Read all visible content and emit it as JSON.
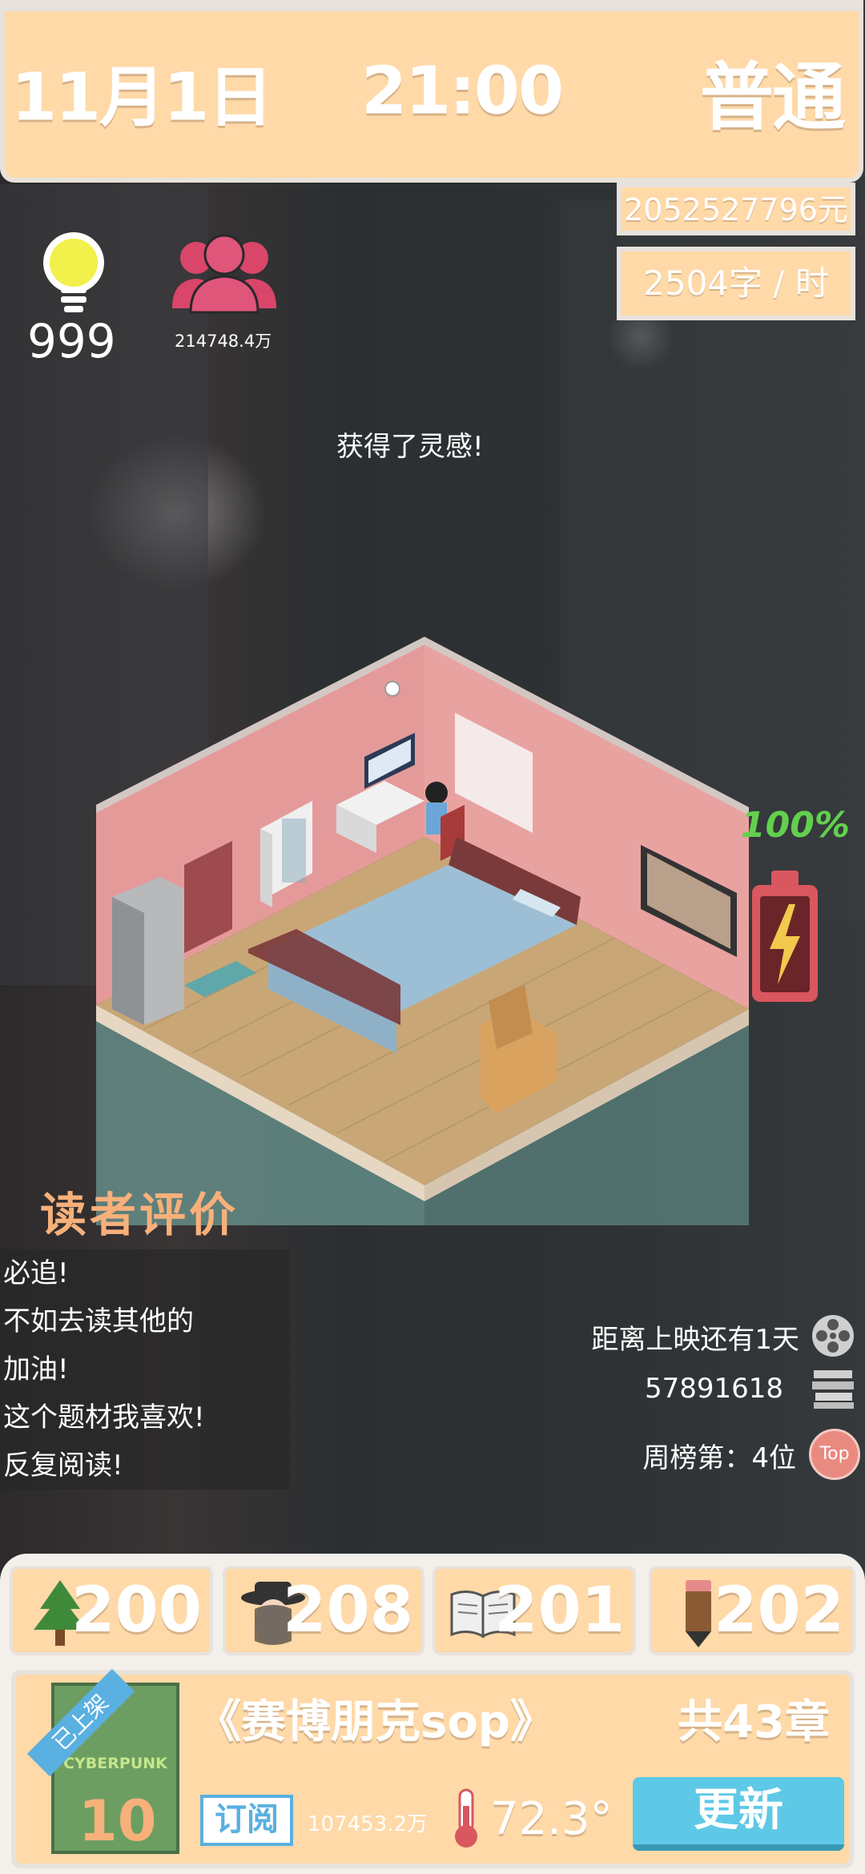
{
  "header": {
    "date": "11月1日",
    "time": "21:00",
    "difficulty": "普通",
    "money": "2052527796元",
    "speed": "2504字 / 时"
  },
  "stats": {
    "inspiration": "999",
    "fans": "214748.4万"
  },
  "notice": "获得了灵感!",
  "battery": {
    "label": "100%",
    "level": 1.0
  },
  "reviews": {
    "title": "读者评价",
    "items": [
      "必追!",
      "不如去读其他的",
      "加油!",
      "这个题材我喜欢!",
      "反复阅读!"
    ]
  },
  "info": {
    "release": "距离上映还有1天",
    "count": "57891618",
    "rank": "周榜第：4位",
    "rank_badge": "Top"
  },
  "resources": [
    {
      "icon": "tree-icon",
      "value": "200"
    },
    {
      "icon": "detective-icon",
      "value": "208"
    },
    {
      "icon": "open-book-icon",
      "value": "201"
    },
    {
      "icon": "pencil-icon",
      "value": "202"
    }
  ],
  "book": {
    "ribbon": "已上架",
    "cover_text": "CYBERPUNK",
    "cover_number": "10",
    "title": "《赛博朋克sop》",
    "chapters": "共43章",
    "subscribe_label": "订阅",
    "subscribers": "107453.2万",
    "heat": "72.3°",
    "update_label": "更新"
  },
  "colors": {
    "panel": "#ffd9a8",
    "accent_pink": "#d9466a",
    "update_button": "#5ec9e6",
    "battery": "#d9575f"
  }
}
